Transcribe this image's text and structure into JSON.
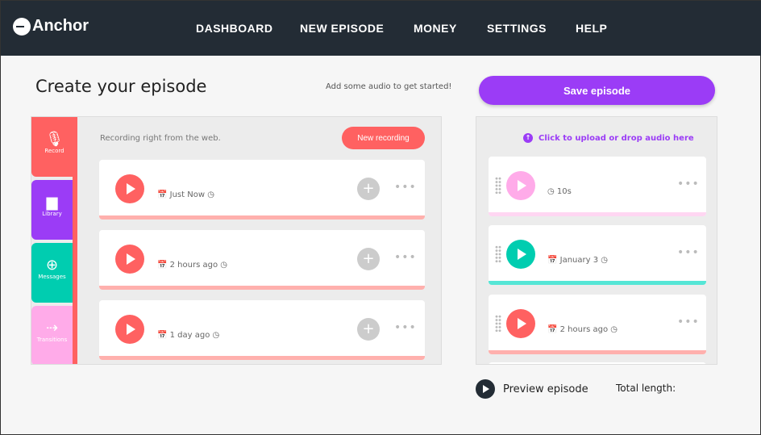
{
  "nav": {
    "brand": "Anchor",
    "items": [
      "DASHBOARD",
      "NEW EPISODE",
      "MONEY",
      "SETTINGS",
      "HELP"
    ]
  },
  "page": {
    "title": "Create your episode",
    "hint": "Add some audio to get started!",
    "save_label": "Save episode"
  },
  "tabs": [
    {
      "label": "Record",
      "icon": "microphone-icon",
      "color": "#ff6161"
    },
    {
      "label": "Library",
      "icon": "folder-icon",
      "color": "#9b3cf6"
    },
    {
      "label": "Messages",
      "icon": "message-plus-icon",
      "color": "#00cdb0"
    },
    {
      "label": "Transitions",
      "icon": "arrow-right-icon",
      "color": "#ffabe9"
    }
  ],
  "record": {
    "info": "Recording right from the web.",
    "new_label": "New recording",
    "items": [
      {
        "meta": "Just Now"
      },
      {
        "meta": "2 hours ago"
      },
      {
        "meta": "1 day ago"
      }
    ]
  },
  "episode": {
    "upload_label": "Click to upload or drop audio here",
    "items": [
      {
        "meta": "10s",
        "color": "#ffabe9",
        "bar": "#ffd6f2"
      },
      {
        "meta": "January 3",
        "color": "#00cdb0",
        "bar": "#55e6d6"
      },
      {
        "meta": "2 hours ago",
        "color": "#ff6161",
        "bar": "#ffb0ad"
      }
    ]
  },
  "footer": {
    "preview_label": "Preview episode",
    "total_label": "Total length:"
  }
}
